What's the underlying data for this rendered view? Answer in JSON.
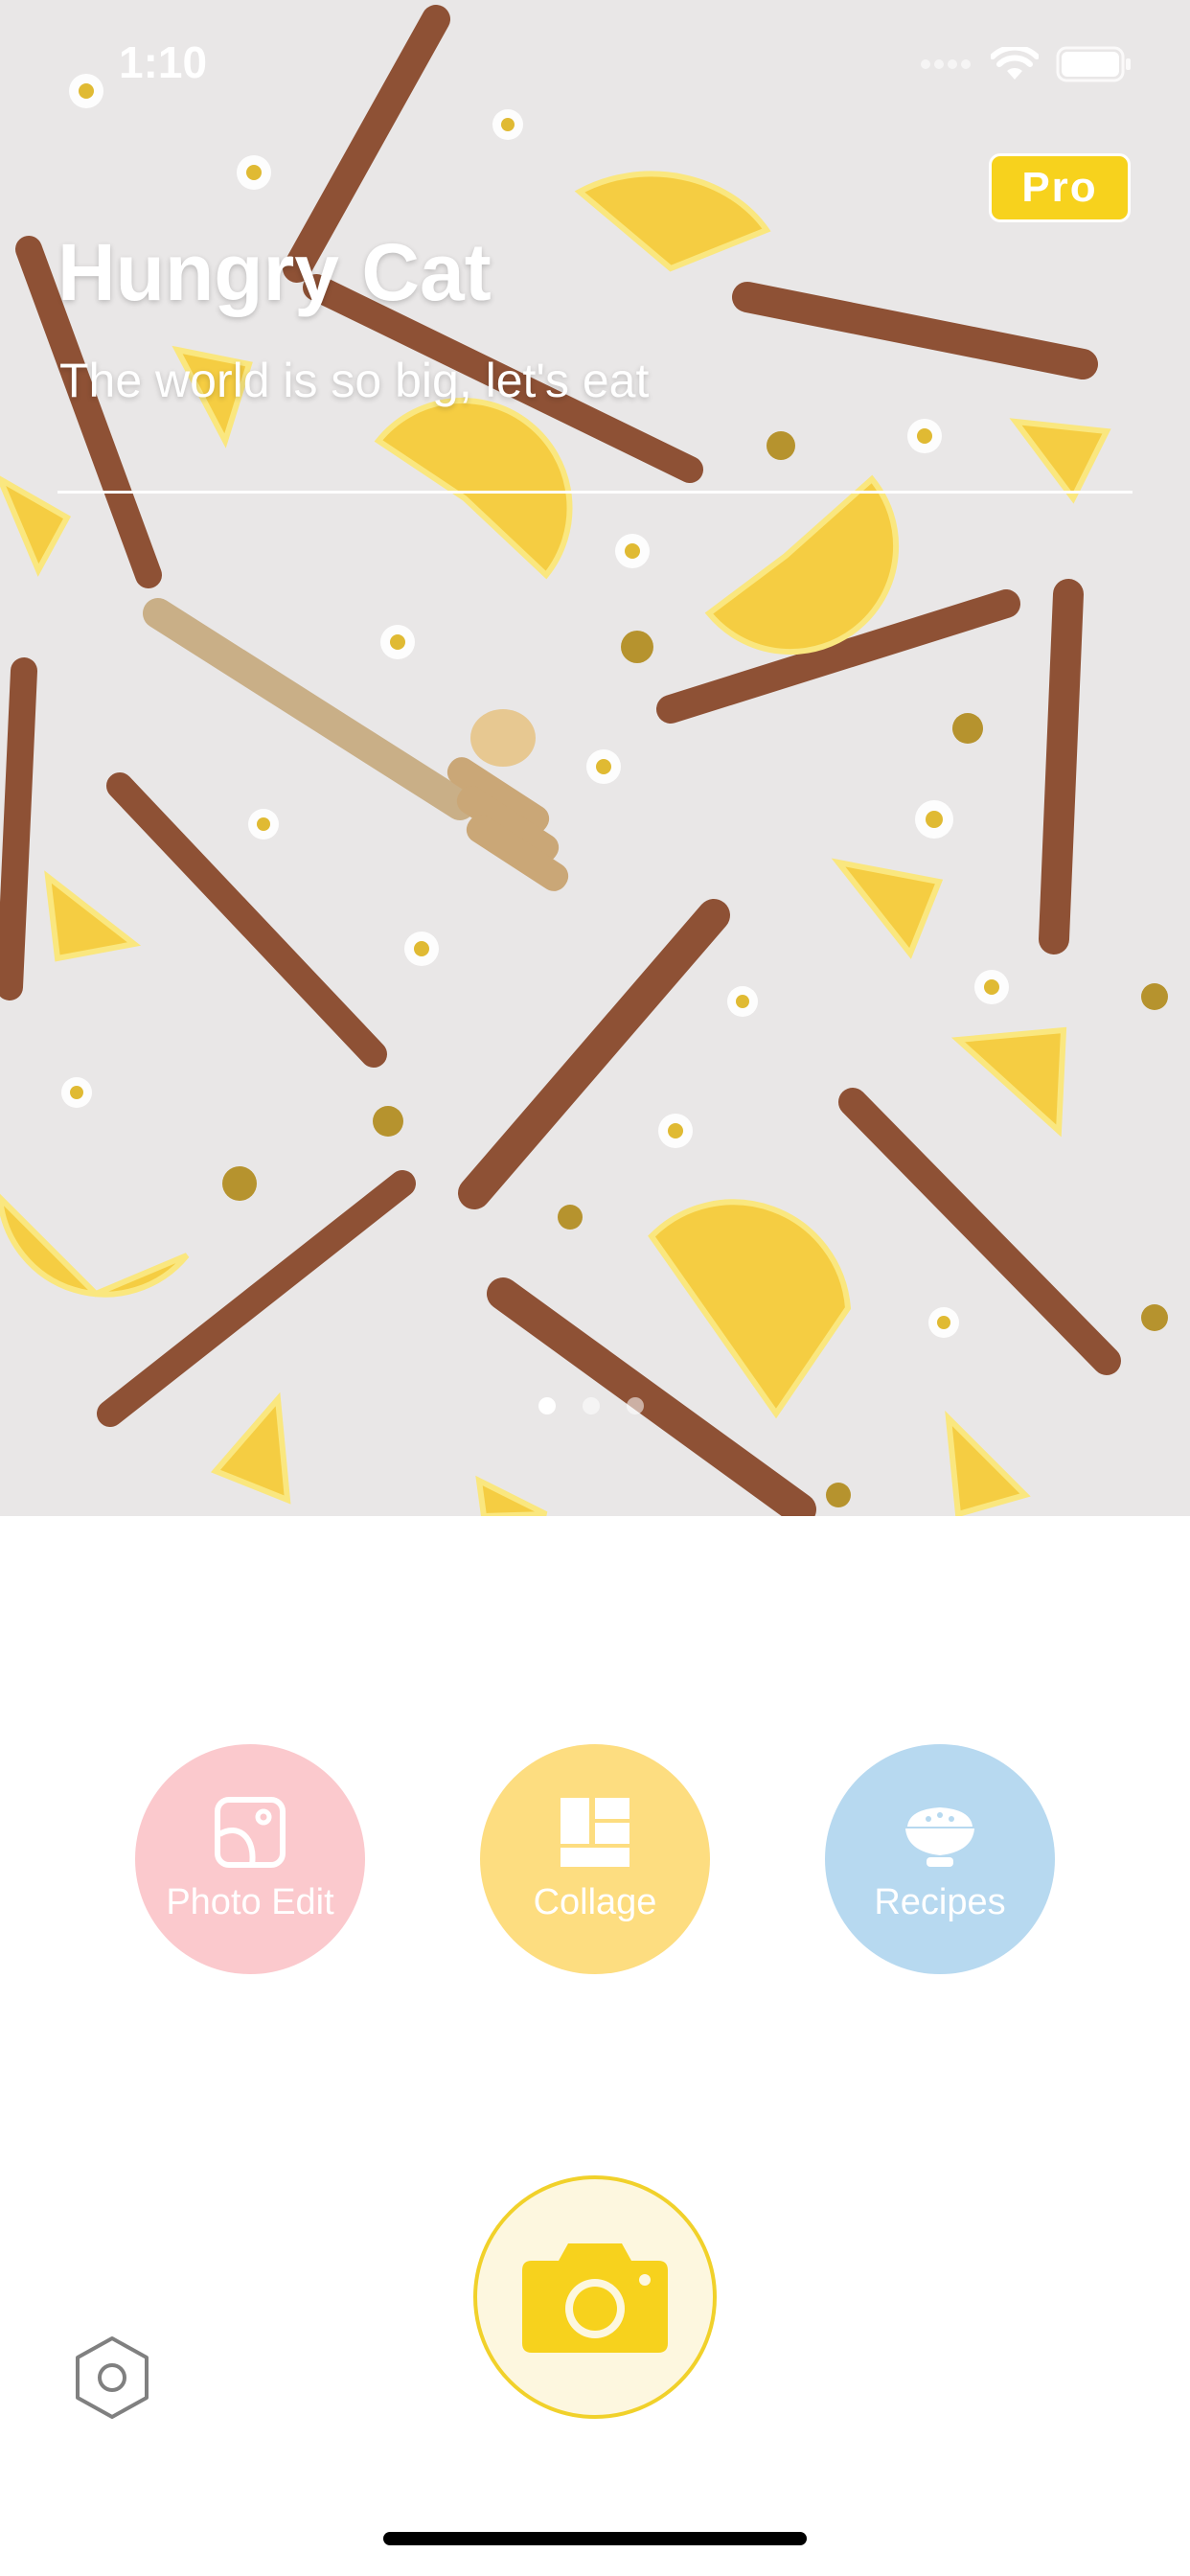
{
  "status": {
    "time": "1:10"
  },
  "hero": {
    "title": "Hungry Cat",
    "subtitle": "The world is so big, let's eat",
    "pro_label": "Pro",
    "page_indicator": {
      "pages": 3,
      "current": 1
    }
  },
  "features": [
    {
      "id": "photo_edit",
      "label": "Photo Edit",
      "icon": "photo-edit-icon",
      "color": "#fbc9cd"
    },
    {
      "id": "collage",
      "label": "Collage",
      "icon": "collage-icon",
      "color": "#fddd80"
    },
    {
      "id": "recipes",
      "label": "Recipes",
      "icon": "rice-bowl-icon",
      "color": "#b7d9f0"
    }
  ],
  "camera": {
    "icon": "camera-icon",
    "color": "#f7d21d"
  },
  "settings": {
    "icon": "settings-hexagon-icon"
  },
  "colors": {
    "accent": "#f7d21d"
  }
}
